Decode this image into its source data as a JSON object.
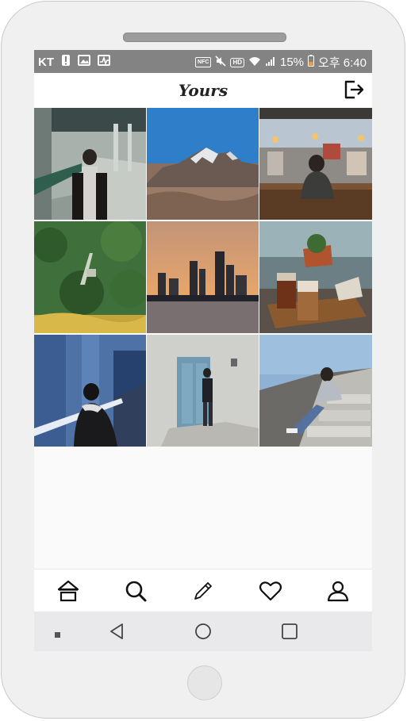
{
  "status_bar": {
    "carrier": "KT",
    "left_icons": [
      "alert-icon",
      "gallery-icon",
      "activity-icon"
    ],
    "right_icons": [
      "nfc-icon",
      "mute-icon",
      "hd-icon",
      "wifi-icon",
      "signal-icon"
    ],
    "battery_percent": "15%",
    "time": "오후 6:40",
    "nfc_label": "NFC",
    "hd_label": "HD"
  },
  "app_bar": {
    "title": "Yours",
    "logout_icon": "logout-icon"
  },
  "photos": [
    {
      "name": "photo-bridge-portrait",
      "subject": "person on bridge walkway"
    },
    {
      "name": "photo-mountain",
      "subject": "snowy mountain under blue sky"
    },
    {
      "name": "photo-cafe-window",
      "subject": "person at cafe window overlooking city"
    },
    {
      "name": "photo-park-aerial",
      "subject": "green park from above"
    },
    {
      "name": "photo-city-sunset",
      "subject": "city skyline at sunset"
    },
    {
      "name": "photo-coffee-table",
      "subject": "iced coffee drinks on tray"
    },
    {
      "name": "photo-railing-blue",
      "subject": "person leaning on railing"
    },
    {
      "name": "photo-door-wall",
      "subject": "person by blue door"
    },
    {
      "name": "photo-stone-wall",
      "subject": "person sitting on stone steps"
    }
  ],
  "bottom_nav": {
    "items": [
      "home-icon",
      "search-icon",
      "pencil-icon",
      "heart-icon",
      "profile-icon"
    ]
  },
  "system_nav": {
    "items": [
      "recent-dot-icon",
      "back-icon",
      "home-circle-icon",
      "overview-square-icon"
    ]
  },
  "colors": {
    "status_bar": "#838383",
    "app_bar": "#ffffff",
    "nav_icons": "#111111",
    "system_nav": "#e9e9eb"
  }
}
